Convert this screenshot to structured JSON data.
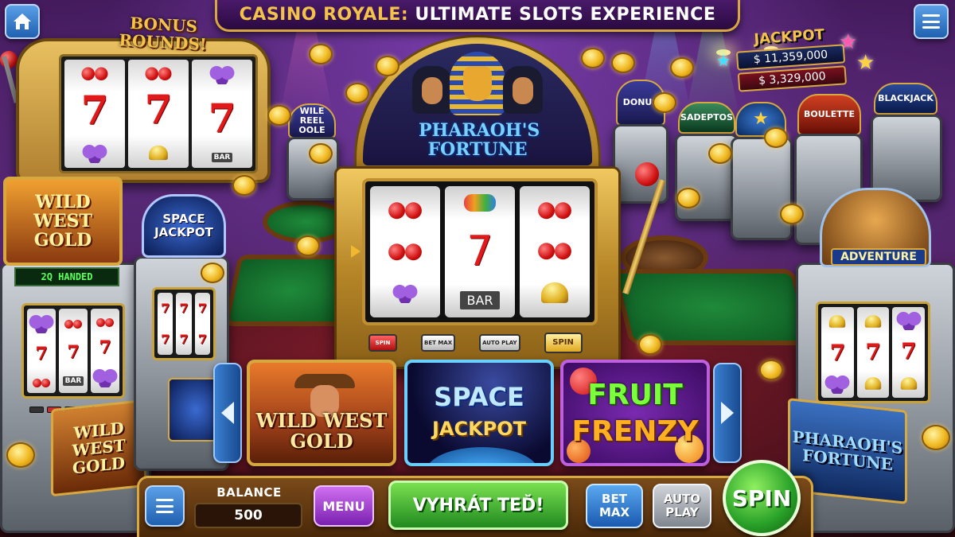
{
  "header": {
    "title_part1": "CASINO ROYALE:",
    "title_part2": "ULTIMATE SLOTS EXPERIENCE",
    "home_icon": "home-icon",
    "menu_icon": "hamburger-menu-icon"
  },
  "background": {
    "bonus_machine_label": "BONUS ROUNDS!",
    "jackpot": {
      "title": "JACKPOT",
      "amount_1": "$ 11,359,000",
      "amount_2": "$ 3,329,000"
    },
    "bg_machines": [
      "WILE REEL OOLE",
      "DONUS",
      "SADEPTOS",
      "BOULETTE",
      "BLACKJACK"
    ],
    "left_machines": {
      "wild_west_top": "WILD WEST GOLD",
      "space_jackpot_top": "SPACE JACKPOT",
      "lcd": "2Q HANDED",
      "wild_west_bottom": "WILD WEST GOLD"
    },
    "right_machines": {
      "adventure": "ADVENTURE",
      "pharaoh_bottom": "PHARAOH'S FORTUNE"
    },
    "reel_symbol_bar": "BAR"
  },
  "featured_machine": {
    "name": "PHARAOH'S FORTUNE",
    "buttons": {
      "spin_small": "SPIN",
      "bet_max_small": "BET MAX",
      "auto_play_small": "AUTO PLAY",
      "spin_gold": "SPIN"
    },
    "reel_symbol_bar": "BAR"
  },
  "carousel": {
    "games": [
      {
        "title_line1": "WILD WEST",
        "title_line2": "GOLD"
      },
      {
        "title_line1": "SPACE",
        "title_line2": "JACKPOT"
      },
      {
        "title_line1": "FRUIT",
        "title_line2": "FRENZY"
      }
    ],
    "prev_icon": "chevron-left-icon",
    "next_icon": "chevron-right-icon"
  },
  "bottom_bar": {
    "balance_label": "BALANCE",
    "balance_value": "500",
    "menu_label": "MENU",
    "win_label": "VYHRÁT TEĎ!",
    "bet_max_label": "BET MAX",
    "auto_play_label": "AUTO PLAY",
    "spin_label": "SPIN"
  },
  "colors": {
    "title_gold": "#f3c24a",
    "spin_green": "#28a028",
    "menu_purple": "#7a20b0",
    "accent_blue": "#2060b0"
  }
}
